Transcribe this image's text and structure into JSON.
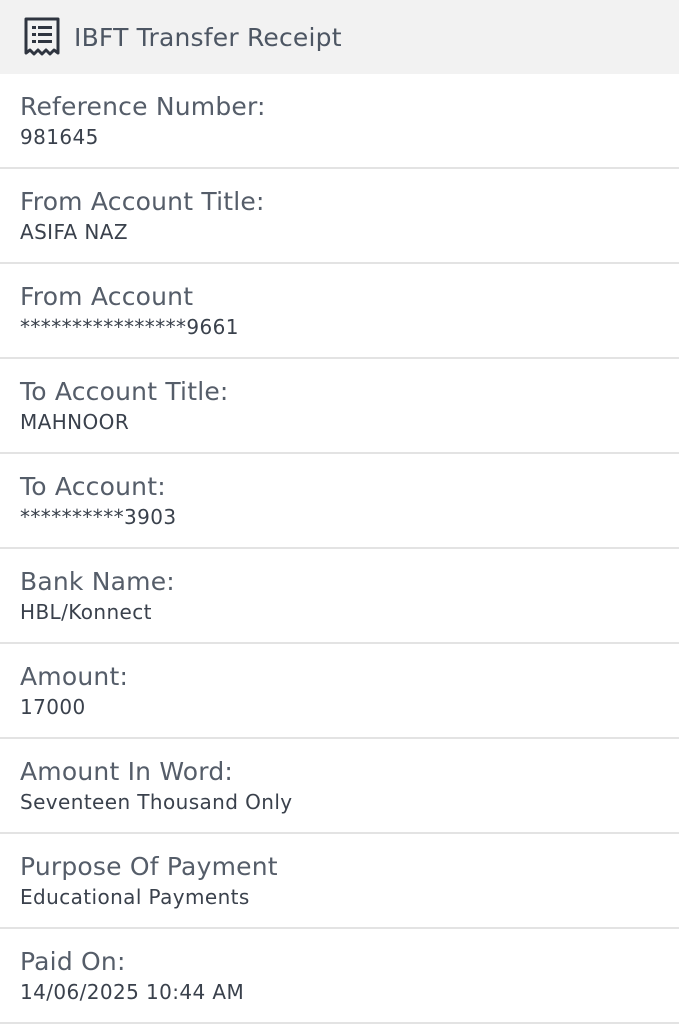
{
  "header": {
    "icon": "receipt-icon",
    "title": "IBFT Transfer Receipt"
  },
  "fields": [
    {
      "label": "Reference Number:",
      "value": "981645"
    },
    {
      "label": "From Account Title:",
      "value": "ASIFA NAZ"
    },
    {
      "label": "From Account",
      "value": "****************9661"
    },
    {
      "label": "To Account Title:",
      "value": "MAHNOOR"
    },
    {
      "label": "To Account:",
      "value": "**********3903"
    },
    {
      "label": "Bank Name:",
      "value": "HBL/Konnect"
    },
    {
      "label": "Amount:",
      "value": "17000"
    },
    {
      "label": "Amount In Word:",
      "value": "Seventeen Thousand Only"
    },
    {
      "label": "Purpose Of Payment",
      "value": "Educational Payments"
    },
    {
      "label": "Paid On:",
      "value": "14/06/2025 10:44 AM"
    }
  ]
}
